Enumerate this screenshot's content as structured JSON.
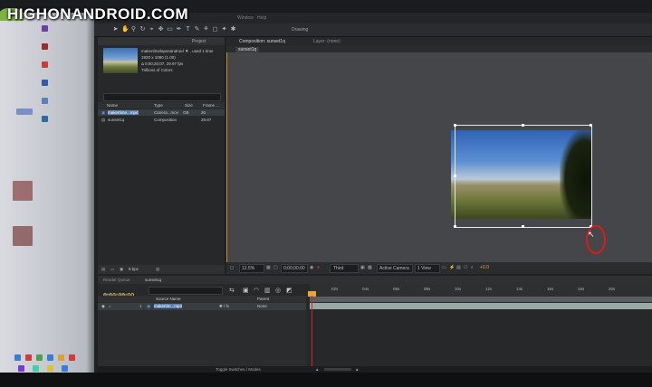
{
  "watermark": "HIGHONANDROID.COM",
  "menubar": {
    "items": [
      "Window",
      "Help"
    ],
    "workspace": "Drawing"
  },
  "project_panel": {
    "tab": "Project",
    "name": "makertimelapseandroid ▼ , used 1 time",
    "details": [
      "1920 x 1080 (1.00)",
      "Δ 0;00;20;07, 29.97 fps",
      "Trillions of Colors"
    ],
    "columns": [
      "Name",
      "Type",
      "Size",
      "Frame ..."
    ],
    "rows": [
      {
        "name": "makertime...mp4",
        "type": "Canera...mov",
        "size": "GB",
        "frame": "30"
      },
      {
        "name": "sunset1q",
        "type": "Composition",
        "size": "",
        "frame": "29.97"
      }
    ],
    "footer": "8 bpc"
  },
  "composition": {
    "tabs": [
      "Composition: sunset1q",
      "Layer: (none)"
    ],
    "sub_tab": "sunset1q",
    "footer": {
      "zoom": "12.5%",
      "timecode": "0;00;00;00",
      "resolution": "Third",
      "camera": "Active Camera",
      "views": "1 View",
      "exposure": "+0.0"
    }
  },
  "timeline": {
    "tab": "Render Queue",
    "comp_tab": "sunset1q",
    "timecode": "0;00;00;00",
    "fps": "00000 (29.97 fps)",
    "columns": [
      "Source Name",
      "Parent"
    ],
    "layer_name": "makertim...mp4",
    "parent": "None",
    "ticks": [
      "02s",
      "04s",
      "06s",
      "08s",
      "10s",
      "12s",
      "14s",
      "16s",
      "18s",
      "20s"
    ],
    "toggle": "Toggle Switches / Modes"
  }
}
